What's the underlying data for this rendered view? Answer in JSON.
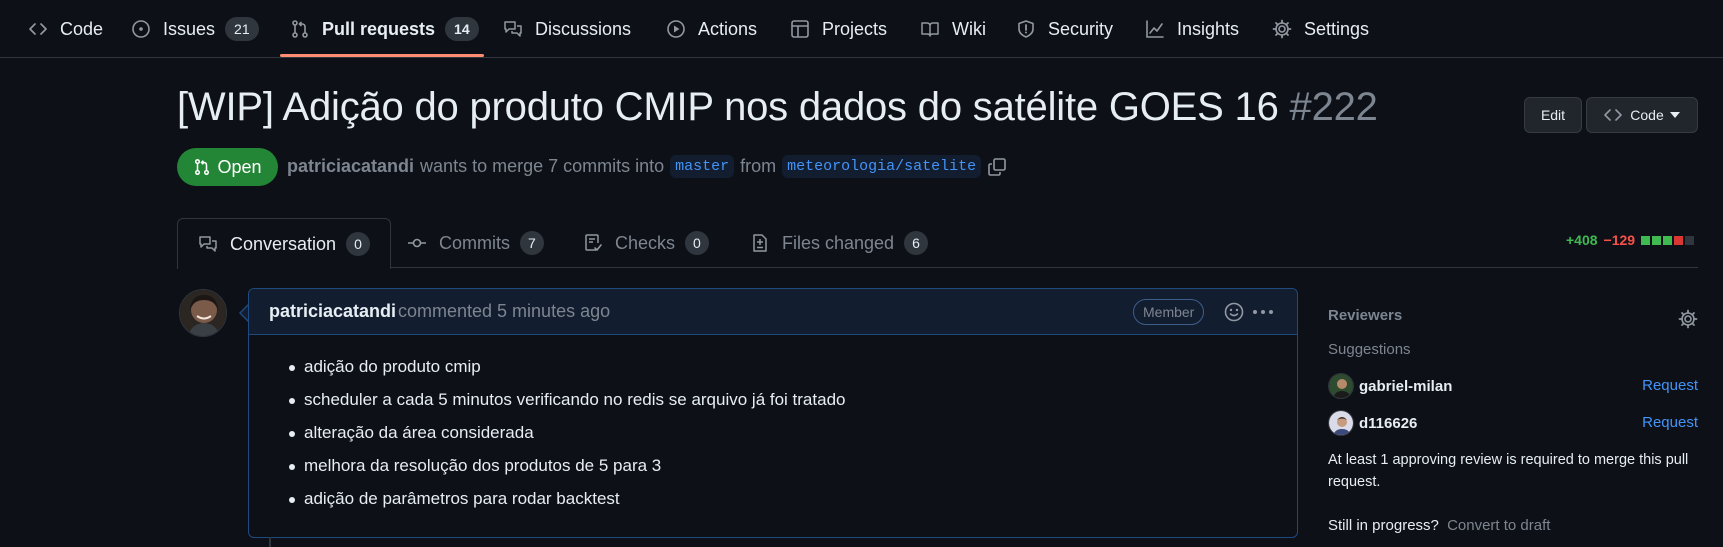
{
  "repo_nav": {
    "items": [
      {
        "label": "Code",
        "icon": "code-icon"
      },
      {
        "label": "Issues",
        "count": "21",
        "icon": "issue-opened-icon"
      },
      {
        "label": "Pull requests",
        "count": "14",
        "icon": "git-pull-request-icon",
        "selected": true
      },
      {
        "label": "Discussions",
        "icon": "comment-discussion-icon"
      },
      {
        "label": "Actions",
        "icon": "play-icon"
      },
      {
        "label": "Projects",
        "icon": "table-icon"
      },
      {
        "label": "Wiki",
        "icon": "book-icon"
      },
      {
        "label": "Security",
        "icon": "shield-icon"
      },
      {
        "label": "Insights",
        "icon": "graph-icon"
      },
      {
        "label": "Settings",
        "icon": "gear-icon"
      }
    ]
  },
  "pr": {
    "title": "[WIP] Adição do produto CMIP nos dados do satélite GOES 16",
    "number": "#222",
    "state": "Open",
    "author": "patriciacatandi",
    "merge_text": "wants to merge 7 commits into",
    "base_branch": "master",
    "from_text": "from",
    "head_branch": "meteorologia/satelite",
    "edit_label": "Edit",
    "code_label": "Code"
  },
  "tabs": [
    {
      "label": "Conversation",
      "count": "0",
      "icon": "comment-discussion-icon",
      "selected": true
    },
    {
      "label": "Commits",
      "count": "7",
      "icon": "git-commit-icon"
    },
    {
      "label": "Checks",
      "count": "0",
      "icon": "checklist-icon"
    },
    {
      "label": "Files changed",
      "count": "6",
      "icon": "file-diff-icon"
    }
  ],
  "diffstat": {
    "additions": "+408",
    "deletions": "−129",
    "blocks": [
      "#3fb950",
      "#3fb950",
      "#3fb950",
      "#da3633",
      "#30363d"
    ]
  },
  "comment": {
    "author": "patriciacatandi",
    "meta": "commented 5 minutes ago",
    "role": "Member",
    "items": [
      "adição do produto cmip",
      "scheduler a cada 5 minutos verificando no redis se arquivo já foi tratado",
      "alteração da área considerada",
      "melhora da resolução dos produtos de 5 para 3",
      "adição de parâmetros para rodar backtest"
    ]
  },
  "sidebar": {
    "heading": "Reviewers",
    "suggestions_label": "Suggestions",
    "reviewers": [
      {
        "name": "gabriel-milan",
        "action": "Request"
      },
      {
        "name": "d116626",
        "action": "Request"
      }
    ],
    "note": "At least 1 approving review is required to merge this pull request.",
    "draft_prefix": "Still in progress?",
    "draft_link": "Convert to draft"
  },
  "colors": {
    "background": "#0d1117",
    "accent_underline": "#fd8c73",
    "open_green": "#238636",
    "link_blue": "#4493f8"
  }
}
